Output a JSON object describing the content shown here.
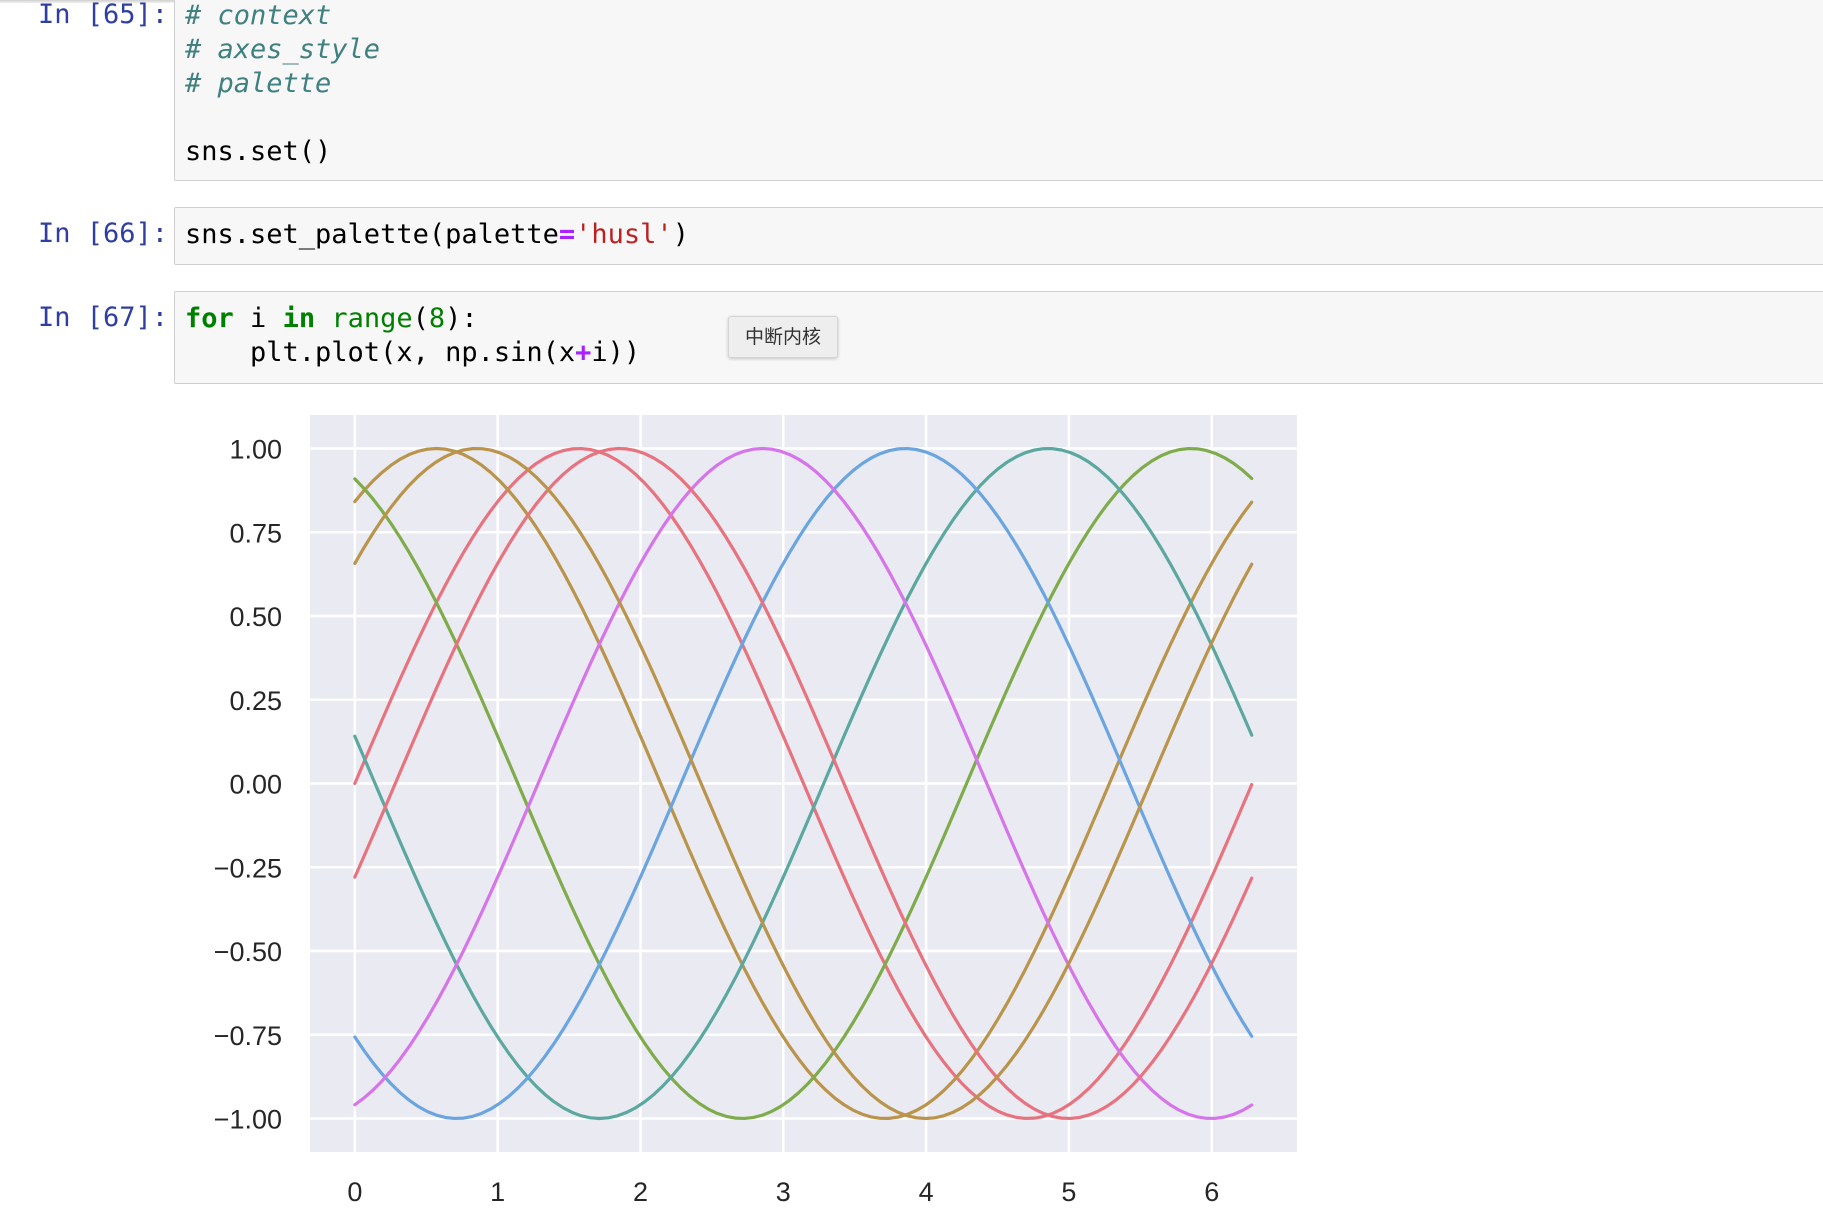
{
  "cells": [
    {
      "prompt": "In [65]:",
      "lines": [
        {
          "comment": "# context"
        },
        {
          "comment": "# axes_style"
        },
        {
          "comment": "# palette"
        },
        {
          "comment": ""
        },
        {
          "text": "sns.set()"
        }
      ]
    },
    {
      "prompt": "In [66]:",
      "line": {
        "pre": "sns.set_palette(palette",
        "eq": "=",
        "str": "'husl'",
        "post": ")"
      }
    },
    {
      "prompt": "In [67]:",
      "line1": {
        "kw1": "for",
        "mid1": " i ",
        "kw2": "in",
        "sp": " ",
        "bi": "range",
        "paren_open": "(",
        "num": "8",
        "end": "):"
      },
      "line2": {
        "pre": "    plt.plot(x, np.sin(x",
        "op": "+",
        "post": "i))"
      }
    }
  ],
  "tooltip": {
    "label": "中断内核"
  },
  "chart_data": {
    "type": "line",
    "function": "sin(x + i)",
    "x_range": [
      0,
      6.28
    ],
    "samples": 100,
    "xlim": [
      -0.314,
      6.597
    ],
    "ylim": [
      -1.1,
      1.1
    ],
    "xticks": [
      0,
      1,
      2,
      3,
      4,
      5,
      6
    ],
    "xtick_labels": [
      "0",
      "1",
      "2",
      "3",
      "4",
      "5",
      "6"
    ],
    "yticks": [
      1.0,
      0.75,
      0.5,
      0.25,
      0.0,
      -0.25,
      -0.5,
      -0.75,
      -1.0
    ],
    "ytick_labels": [
      "1.00",
      "0.75",
      "0.50",
      "0.25",
      "0.00",
      "−0.25",
      "−0.50",
      "−0.75",
      "−1.00"
    ],
    "grid": true,
    "background": "#eaeaf2",
    "series": [
      {
        "i": 0,
        "color": "#e7737f"
      },
      {
        "i": 1,
        "color": "#b9944a"
      },
      {
        "i": 2,
        "color": "#7fac4b"
      },
      {
        "i": 3,
        "color": "#5ba8a0"
      },
      {
        "i": 4,
        "color": "#6aa5e0"
      },
      {
        "i": 5,
        "color": "#d675ea"
      },
      {
        "i": 6,
        "color": "#e7737f"
      },
      {
        "i": 7,
        "color": "#b9944a"
      }
    ]
  }
}
